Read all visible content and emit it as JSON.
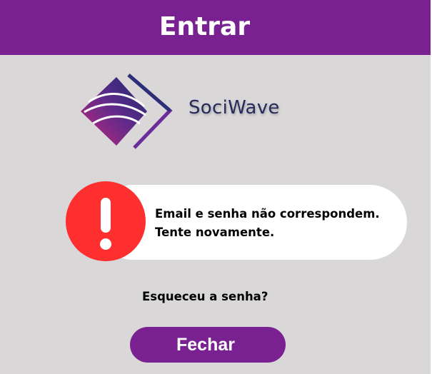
{
  "header": {
    "title": "Entrar"
  },
  "brand": {
    "name": "SociWave",
    "logo_icon": "sociwave-logo-icon"
  },
  "alert": {
    "icon": "exclamation-icon",
    "message_line1": "Email e senha não correspondem.",
    "message_line2": "Tente novamente."
  },
  "links": {
    "forgot_password": "Esqueceu a senha?"
  },
  "actions": {
    "close_label": "Fechar"
  },
  "colors": {
    "accent": "#7a2191",
    "background": "#d9d7d8",
    "alert": "#ff2f2f",
    "brand_text": "#262a5c"
  }
}
